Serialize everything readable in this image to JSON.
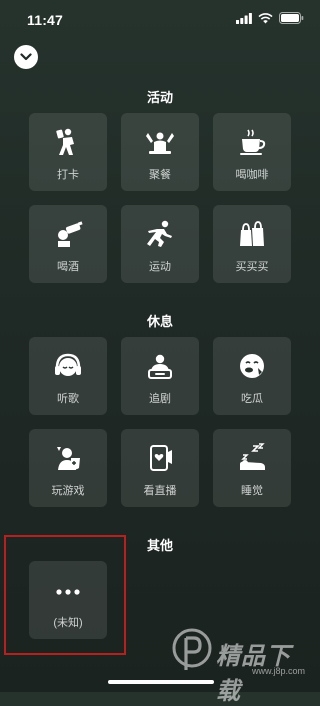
{
  "status_bar": {
    "time": "11:47"
  },
  "sections": [
    {
      "title": "活动",
      "items": [
        {
          "label": "打卡",
          "icon": "check-in-icon"
        },
        {
          "label": "聚餐",
          "icon": "dinner-party-icon"
        },
        {
          "label": "喝咖啡",
          "icon": "coffee-cup-icon"
        },
        {
          "label": "喝酒",
          "icon": "drinking-icon"
        },
        {
          "label": "运动",
          "icon": "exercise-icon"
        },
        {
          "label": "买买买",
          "icon": "shopping-bag-icon"
        }
      ]
    },
    {
      "title": "休息",
      "items": [
        {
          "label": "听歌",
          "icon": "headphones-icon"
        },
        {
          "label": "追剧",
          "icon": "tv-watching-icon"
        },
        {
          "label": "吃瓜",
          "icon": "gossip-face-icon"
        },
        {
          "label": "玩游戏",
          "icon": "gaming-icon"
        },
        {
          "label": "看直播",
          "icon": "live-stream-icon"
        },
        {
          "label": "睡觉",
          "icon": "sleep-icon"
        }
      ]
    },
    {
      "title": "其他",
      "items": [
        {
          "label": "(未知)",
          "icon": "more-dots-icon"
        }
      ]
    }
  ],
  "watermark": {
    "text": "精品下载",
    "url": "www.j8p.com"
  },
  "colors": {
    "background": "#1f2925",
    "tile": "#3a4440",
    "highlight": "#b81f1f"
  }
}
